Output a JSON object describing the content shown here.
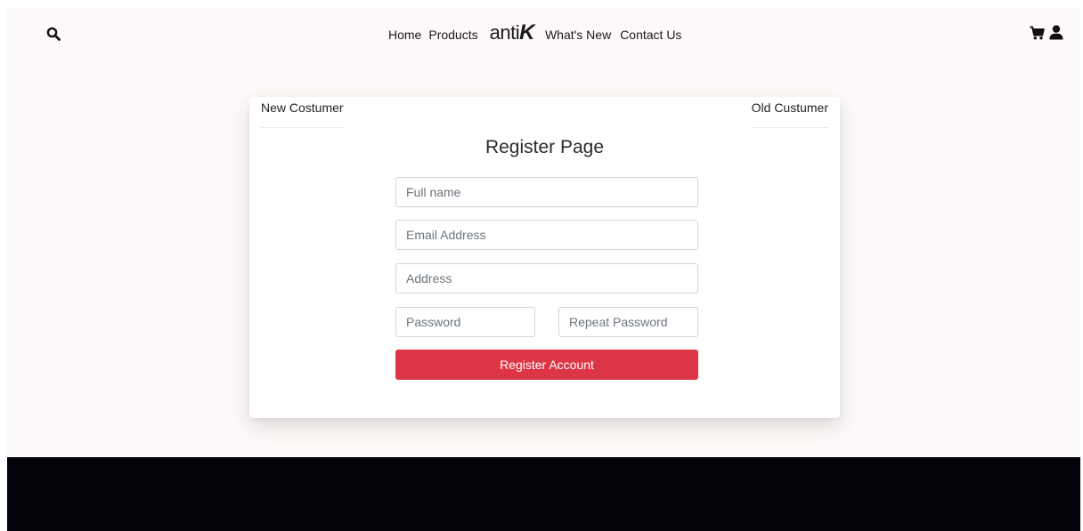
{
  "header": {
    "nav": {
      "home": "Home",
      "products": "Products",
      "logo": {
        "prefix": "anti",
        "suffix": "K"
      },
      "whats_new": "What's New",
      "contact": "Contact Us"
    },
    "icons": [
      "search-icon",
      "cart-icon",
      "user-icon"
    ]
  },
  "register_card": {
    "tabs": {
      "new_customer": "New Costumer",
      "old_customer": "Old Custumer"
    },
    "title": "Register Page",
    "fields": {
      "full_name": {
        "placeholder": "Full name",
        "value": ""
      },
      "email": {
        "placeholder": "Email Address",
        "value": ""
      },
      "address": {
        "placeholder": "Address",
        "value": ""
      },
      "password": {
        "placeholder": "Password",
        "value": ""
      },
      "repeat_password": {
        "placeholder": "Repeat Password",
        "value": ""
      }
    },
    "submit_label": "Register Account"
  },
  "colors": {
    "page_background": "#fdf9f8",
    "footer_background": "#020409",
    "button_accent": "#dc3545",
    "logo_color": "#0f2a30"
  }
}
